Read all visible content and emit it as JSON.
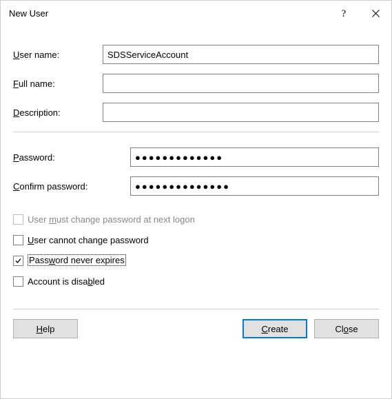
{
  "window": {
    "title": "New User"
  },
  "labels": {
    "username": "User name:",
    "fullname": "Full name:",
    "description": "Description:",
    "password": "Password:",
    "confirm": "Confirm password:"
  },
  "fields": {
    "username": "SDSServiceAccount",
    "fullname": "",
    "description": "",
    "password_mask": "●●●●●●●●●●●●●",
    "confirm_mask": "●●●●●●●●●●●●●●"
  },
  "checkboxes": {
    "must_change": {
      "label_pre": "User ",
      "label_ul": "m",
      "label_post": "ust change password at next logon",
      "checked": false,
      "disabled": true
    },
    "cannot_change": {
      "label_pre": "",
      "label_ul": "U",
      "label_post": "ser cannot change password",
      "checked": false,
      "disabled": false
    },
    "never_expires": {
      "label_pre": "Pass",
      "label_ul": "w",
      "label_post": "ord never expires",
      "checked": true,
      "disabled": false
    },
    "disabled_acct": {
      "label_pre": "Account is disa",
      "label_ul": "b",
      "label_post": "led",
      "checked": false,
      "disabled": false
    }
  },
  "buttons": {
    "help": "Help",
    "create": "Create",
    "close": "Close"
  },
  "underline_chars": {
    "username": "U",
    "username_rest": "ser name:",
    "fullname": "F",
    "fullname_rest": "ull name:",
    "description": "D",
    "description_rest": "escription:",
    "password": "P",
    "password_rest": "assword:",
    "confirm": "C",
    "confirm_rest": "onfirm password:",
    "help": "H",
    "help_rest": "elp",
    "create": "C",
    "create_rest": "reate",
    "close_pre": "Cl",
    "close_ul": "o",
    "close_post": "se"
  }
}
